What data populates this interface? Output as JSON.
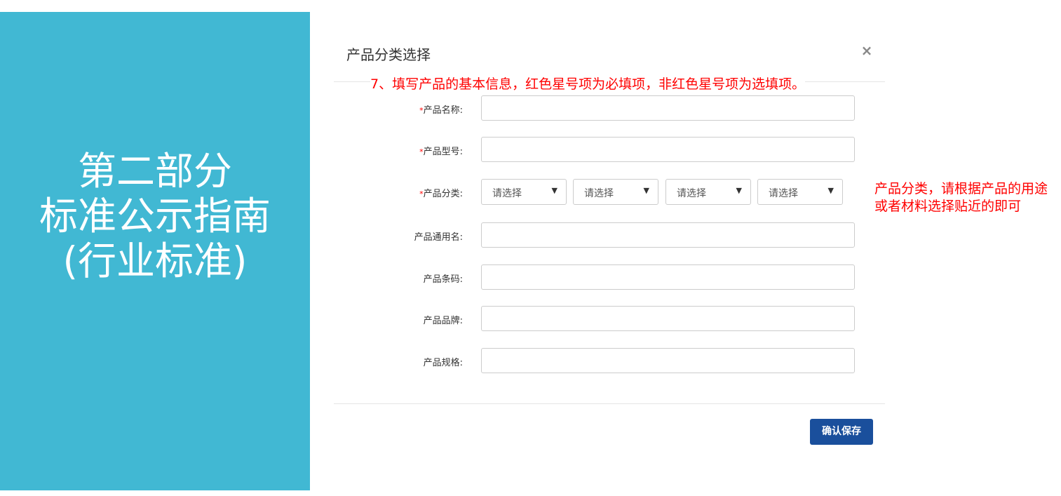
{
  "slide": {
    "title_lines": [
      "第二部分",
      "标准公示指南",
      "(行业标准)"
    ],
    "accent_color": "#41b8d3"
  },
  "modal": {
    "title": "产品分类选择",
    "close_icon": "×",
    "save_label": "确认保存",
    "save_color": "#1a4f9c"
  },
  "annotations": {
    "top": "7、填写产品的基本信息，红色星号项为必填项，非红色星号项为选填项。",
    "right": "产品分类，请根据产品的用途或者材料选择贴近的即可",
    "color": "#ff0000"
  },
  "form": {
    "required_mark": "*",
    "fields": [
      {
        "label": "产品名称:",
        "required": true,
        "value": ""
      },
      {
        "label": "产品型号:",
        "required": true,
        "value": ""
      },
      {
        "label": "产品分类:",
        "required": true,
        "selects": [
          "请选择",
          "请选择",
          "请选择",
          "请选择"
        ]
      },
      {
        "label": "产品通用名:",
        "required": false,
        "value": ""
      },
      {
        "label": "产品条码:",
        "required": false,
        "value": ""
      },
      {
        "label": "产品品牌:",
        "required": false,
        "value": ""
      },
      {
        "label": "产品规格:",
        "required": false,
        "value": ""
      }
    ]
  }
}
